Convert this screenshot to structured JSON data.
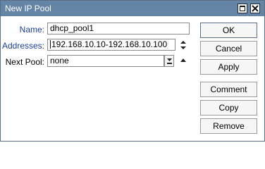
{
  "window": {
    "title": "New IP Pool",
    "maximize_icon": "maximize-icon",
    "close_icon": "close-icon"
  },
  "form": {
    "name_label": "Name:",
    "name_value": "dhcp_pool1",
    "addresses_label": "Addresses:",
    "addresses_value": "192.168.10.10-192.168.10.100",
    "next_pool_label": "Next Pool:",
    "next_pool_value": "none"
  },
  "buttons": {
    "ok": "OK",
    "cancel": "Cancel",
    "apply": "Apply",
    "comment": "Comment",
    "copy": "Copy",
    "remove": "Remove"
  },
  "colors": {
    "titlebar": "#6585a7",
    "label_blue": "#1d3fa5"
  }
}
